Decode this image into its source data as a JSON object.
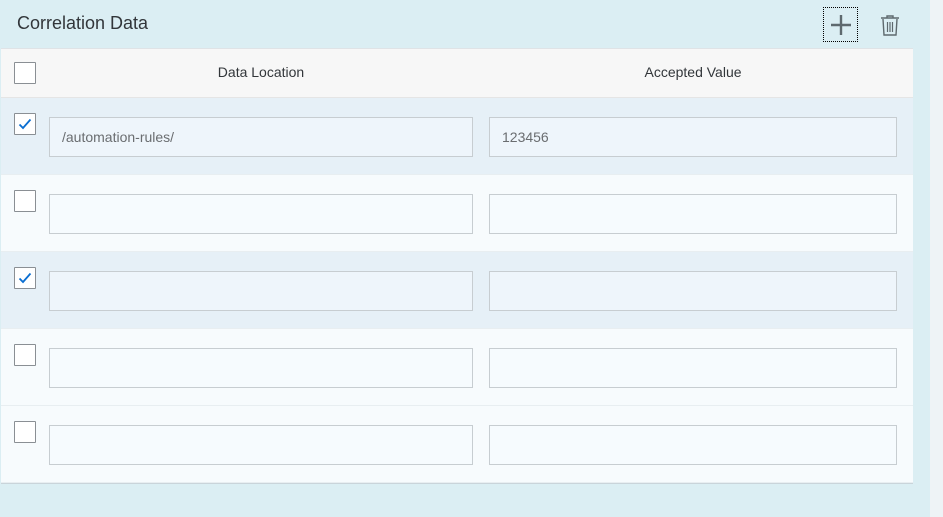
{
  "toolbar": {
    "title": "Correlation Data"
  },
  "table": {
    "headers": {
      "data_location": "Data Location",
      "accepted_value": "Accepted Value"
    },
    "rows": [
      {
        "selected": true,
        "data_location": "/automation-rules/",
        "accepted_value": "123456"
      },
      {
        "selected": false,
        "data_location": "",
        "accepted_value": ""
      },
      {
        "selected": true,
        "data_location": "",
        "accepted_value": ""
      },
      {
        "selected": false,
        "data_location": "",
        "accepted_value": ""
      },
      {
        "selected": false,
        "data_location": "",
        "accepted_value": ""
      }
    ]
  },
  "colors": {
    "panel_bg": "#dbeef3",
    "selected_row_bg": "#e6f0f7",
    "check_color": "#0a6ed1",
    "icon_color": "#5e696e"
  },
  "icons": {
    "add": "plus-icon",
    "delete": "trash-icon"
  }
}
